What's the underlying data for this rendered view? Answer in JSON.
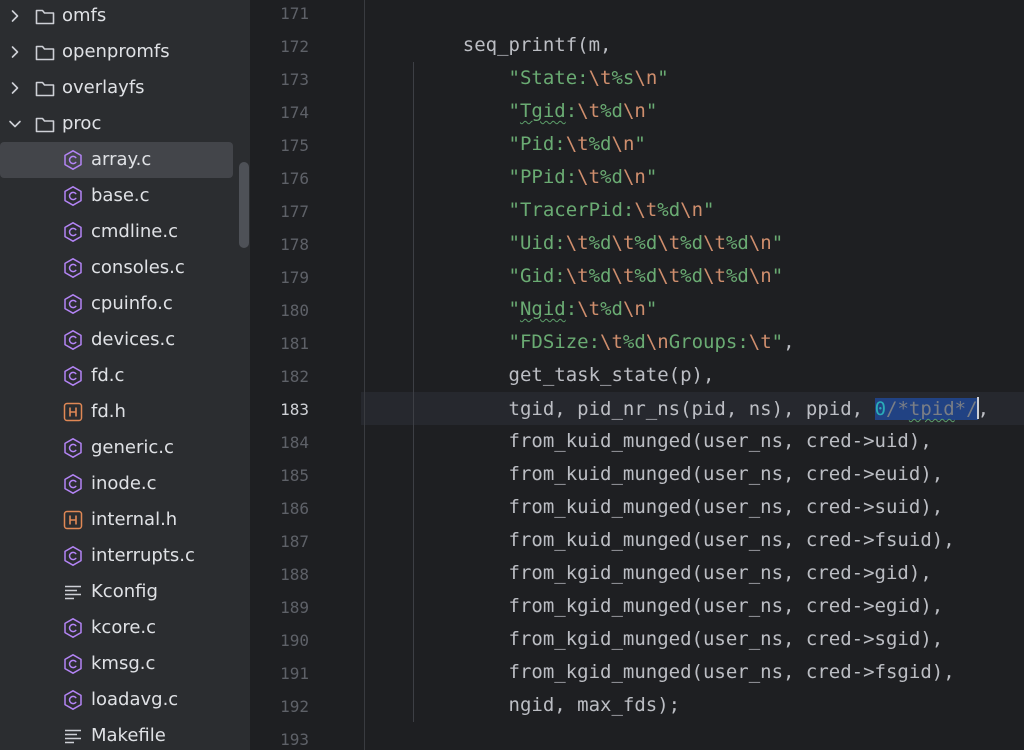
{
  "sidebar": {
    "items": [
      {
        "label": "omfs",
        "kind": "folder",
        "expanded": false,
        "depth": 0,
        "selected": false,
        "icon": "folder-icon"
      },
      {
        "label": "openpromfs",
        "kind": "folder",
        "expanded": false,
        "depth": 0,
        "selected": false,
        "icon": "folder-icon"
      },
      {
        "label": "overlayfs",
        "kind": "folder",
        "expanded": false,
        "depth": 0,
        "selected": false,
        "icon": "folder-icon"
      },
      {
        "label": "proc",
        "kind": "folder",
        "expanded": true,
        "depth": 0,
        "selected": false,
        "icon": "folder-icon"
      },
      {
        "label": "array.c",
        "kind": "c",
        "depth": 1,
        "selected": true,
        "icon": "c-file-icon"
      },
      {
        "label": "base.c",
        "kind": "c",
        "depth": 1,
        "selected": false,
        "icon": "c-file-icon"
      },
      {
        "label": "cmdline.c",
        "kind": "c",
        "depth": 1,
        "selected": false,
        "icon": "c-file-icon"
      },
      {
        "label": "consoles.c",
        "kind": "c",
        "depth": 1,
        "selected": false,
        "icon": "c-file-icon"
      },
      {
        "label": "cpuinfo.c",
        "kind": "c",
        "depth": 1,
        "selected": false,
        "icon": "c-file-icon"
      },
      {
        "label": "devices.c",
        "kind": "c",
        "depth": 1,
        "selected": false,
        "icon": "c-file-icon"
      },
      {
        "label": "fd.c",
        "kind": "c",
        "depth": 1,
        "selected": false,
        "icon": "c-file-icon"
      },
      {
        "label": "fd.h",
        "kind": "h",
        "depth": 1,
        "selected": false,
        "icon": "h-file-icon"
      },
      {
        "label": "generic.c",
        "kind": "c",
        "depth": 1,
        "selected": false,
        "icon": "c-file-icon"
      },
      {
        "label": "inode.c",
        "kind": "c",
        "depth": 1,
        "selected": false,
        "icon": "c-file-icon"
      },
      {
        "label": "internal.h",
        "kind": "h",
        "depth": 1,
        "selected": false,
        "icon": "h-file-icon"
      },
      {
        "label": "interrupts.c",
        "kind": "c",
        "depth": 1,
        "selected": false,
        "icon": "c-file-icon"
      },
      {
        "label": "Kconfig",
        "kind": "text",
        "depth": 1,
        "selected": false,
        "icon": "text-file-icon"
      },
      {
        "label": "kcore.c",
        "kind": "c",
        "depth": 1,
        "selected": false,
        "icon": "c-file-icon"
      },
      {
        "label": "kmsg.c",
        "kind": "c",
        "depth": 1,
        "selected": false,
        "icon": "c-file-icon"
      },
      {
        "label": "loadavg.c",
        "kind": "c",
        "depth": 1,
        "selected": false,
        "icon": "c-file-icon"
      },
      {
        "label": "Makefile",
        "kind": "text",
        "depth": 1,
        "selected": false,
        "icon": "text-file-icon"
      }
    ]
  },
  "editor": {
    "current_line": "183",
    "lines": [
      {
        "n": "171",
        "tokens": []
      },
      {
        "n": "172",
        "tokens": [
          {
            "t": "    seq_printf(m,",
            "c": "id"
          }
        ]
      },
      {
        "n": "173",
        "tokens": [
          {
            "t": "        ",
            "c": "id"
          },
          {
            "t": "\"State:",
            "c": "str"
          },
          {
            "t": "\\t",
            "c": "esc"
          },
          {
            "t": "%s",
            "c": "str"
          },
          {
            "t": "\\n",
            "c": "esc"
          },
          {
            "t": "\"",
            "c": "str"
          }
        ]
      },
      {
        "n": "174",
        "tokens": [
          {
            "t": "        ",
            "c": "id"
          },
          {
            "t": "\"",
            "c": "str"
          },
          {
            "t": "Tgid",
            "c": "str typo"
          },
          {
            "t": ":",
            "c": "str"
          },
          {
            "t": "\\t",
            "c": "esc"
          },
          {
            "t": "%d",
            "c": "str"
          },
          {
            "t": "\\n",
            "c": "esc"
          },
          {
            "t": "\"",
            "c": "str"
          }
        ]
      },
      {
        "n": "175",
        "tokens": [
          {
            "t": "        ",
            "c": "id"
          },
          {
            "t": "\"Pid:",
            "c": "str"
          },
          {
            "t": "\\t",
            "c": "esc"
          },
          {
            "t": "%d",
            "c": "str"
          },
          {
            "t": "\\n",
            "c": "esc"
          },
          {
            "t": "\"",
            "c": "str"
          }
        ]
      },
      {
        "n": "176",
        "tokens": [
          {
            "t": "        ",
            "c": "id"
          },
          {
            "t": "\"PPid:",
            "c": "str"
          },
          {
            "t": "\\t",
            "c": "esc"
          },
          {
            "t": "%d",
            "c": "str"
          },
          {
            "t": "\\n",
            "c": "esc"
          },
          {
            "t": "\"",
            "c": "str"
          }
        ]
      },
      {
        "n": "177",
        "tokens": [
          {
            "t": "        ",
            "c": "id"
          },
          {
            "t": "\"TracerPid:",
            "c": "str"
          },
          {
            "t": "\\t",
            "c": "esc"
          },
          {
            "t": "%d",
            "c": "str"
          },
          {
            "t": "\\n",
            "c": "esc"
          },
          {
            "t": "\"",
            "c": "str"
          }
        ]
      },
      {
        "n": "178",
        "tokens": [
          {
            "t": "        ",
            "c": "id"
          },
          {
            "t": "\"Uid:",
            "c": "str"
          },
          {
            "t": "\\t",
            "c": "esc"
          },
          {
            "t": "%d",
            "c": "str"
          },
          {
            "t": "\\t",
            "c": "esc"
          },
          {
            "t": "%d",
            "c": "str"
          },
          {
            "t": "\\t",
            "c": "esc"
          },
          {
            "t": "%d",
            "c": "str"
          },
          {
            "t": "\\t",
            "c": "esc"
          },
          {
            "t": "%d",
            "c": "str"
          },
          {
            "t": "\\n",
            "c": "esc"
          },
          {
            "t": "\"",
            "c": "str"
          }
        ]
      },
      {
        "n": "179",
        "tokens": [
          {
            "t": "        ",
            "c": "id"
          },
          {
            "t": "\"Gid:",
            "c": "str"
          },
          {
            "t": "\\t",
            "c": "esc"
          },
          {
            "t": "%d",
            "c": "str"
          },
          {
            "t": "\\t",
            "c": "esc"
          },
          {
            "t": "%d",
            "c": "str"
          },
          {
            "t": "\\t",
            "c": "esc"
          },
          {
            "t": "%d",
            "c": "str"
          },
          {
            "t": "\\t",
            "c": "esc"
          },
          {
            "t": "%d",
            "c": "str"
          },
          {
            "t": "\\n",
            "c": "esc"
          },
          {
            "t": "\"",
            "c": "str"
          }
        ]
      },
      {
        "n": "180",
        "tokens": [
          {
            "t": "        ",
            "c": "id"
          },
          {
            "t": "\"",
            "c": "str"
          },
          {
            "t": "Ngid",
            "c": "str typo"
          },
          {
            "t": ":",
            "c": "str"
          },
          {
            "t": "\\t",
            "c": "esc"
          },
          {
            "t": "%d",
            "c": "str"
          },
          {
            "t": "\\n",
            "c": "esc"
          },
          {
            "t": "\"",
            "c": "str"
          }
        ]
      },
      {
        "n": "181",
        "tokens": [
          {
            "t": "        ",
            "c": "id"
          },
          {
            "t": "\"FDSize:",
            "c": "str"
          },
          {
            "t": "\\t",
            "c": "esc"
          },
          {
            "t": "%d",
            "c": "str"
          },
          {
            "t": "\\n",
            "c": "esc"
          },
          {
            "t": "Groups:",
            "c": "str"
          },
          {
            "t": "\\t",
            "c": "esc"
          },
          {
            "t": "\"",
            "c": "str"
          },
          {
            "t": ",",
            "c": "id"
          }
        ]
      },
      {
        "n": "182",
        "tokens": [
          {
            "t": "        get_task_state(p),",
            "c": "id"
          }
        ]
      },
      {
        "n": "183",
        "tokens": [
          {
            "t": "        tgid, pid_nr_ns(pid, ns), ppid, ",
            "c": "id"
          },
          {
            "t": "0",
            "c": "num sel"
          },
          {
            "t": "/*",
            "c": "cmt sel"
          },
          {
            "t": "tpid",
            "c": "cmt sel typo"
          },
          {
            "t": "*/",
            "c": "cmt sel"
          },
          {
            "t": "",
            "c": "caret"
          },
          {
            "t": ",",
            "c": "id"
          }
        ]
      },
      {
        "n": "184",
        "tokens": [
          {
            "t": "        from_kuid_munged(user_ns, cred->uid),",
            "c": "id"
          }
        ]
      },
      {
        "n": "185",
        "tokens": [
          {
            "t": "        from_kuid_munged(user_ns, cred->euid),",
            "c": "id"
          }
        ]
      },
      {
        "n": "186",
        "tokens": [
          {
            "t": "        from_kuid_munged(user_ns, cred->suid),",
            "c": "id"
          }
        ]
      },
      {
        "n": "187",
        "tokens": [
          {
            "t": "        from_kuid_munged(user_ns, cred->fsuid),",
            "c": "id"
          }
        ]
      },
      {
        "n": "188",
        "tokens": [
          {
            "t": "        from_kgid_munged(user_ns, cred->gid),",
            "c": "id"
          }
        ]
      },
      {
        "n": "189",
        "tokens": [
          {
            "t": "        from_kgid_munged(user_ns, cred->egid),",
            "c": "id"
          }
        ]
      },
      {
        "n": "190",
        "tokens": [
          {
            "t": "        from_kgid_munged(user_ns, cred->sgid),",
            "c": "id"
          }
        ]
      },
      {
        "n": "191",
        "tokens": [
          {
            "t": "        from_kgid_munged(user_ns, cred->fsgid),",
            "c": "id"
          }
        ]
      },
      {
        "n": "192",
        "tokens": [
          {
            "t": "        ngid, max_fds);",
            "c": "id"
          }
        ]
      },
      {
        "n": "193",
        "tokens": []
      }
    ]
  },
  "colors": {
    "sidebar_bg": "#2b2d30",
    "editor_bg": "#1e1f22",
    "selected_row": "#43454a",
    "string": "#6aab73",
    "escape": "#cf8e6d",
    "number": "#2aacb8",
    "comment": "#7a7e85",
    "selection": "#214283",
    "c_icon": "#b384f5",
    "h_icon": "#e08855"
  }
}
